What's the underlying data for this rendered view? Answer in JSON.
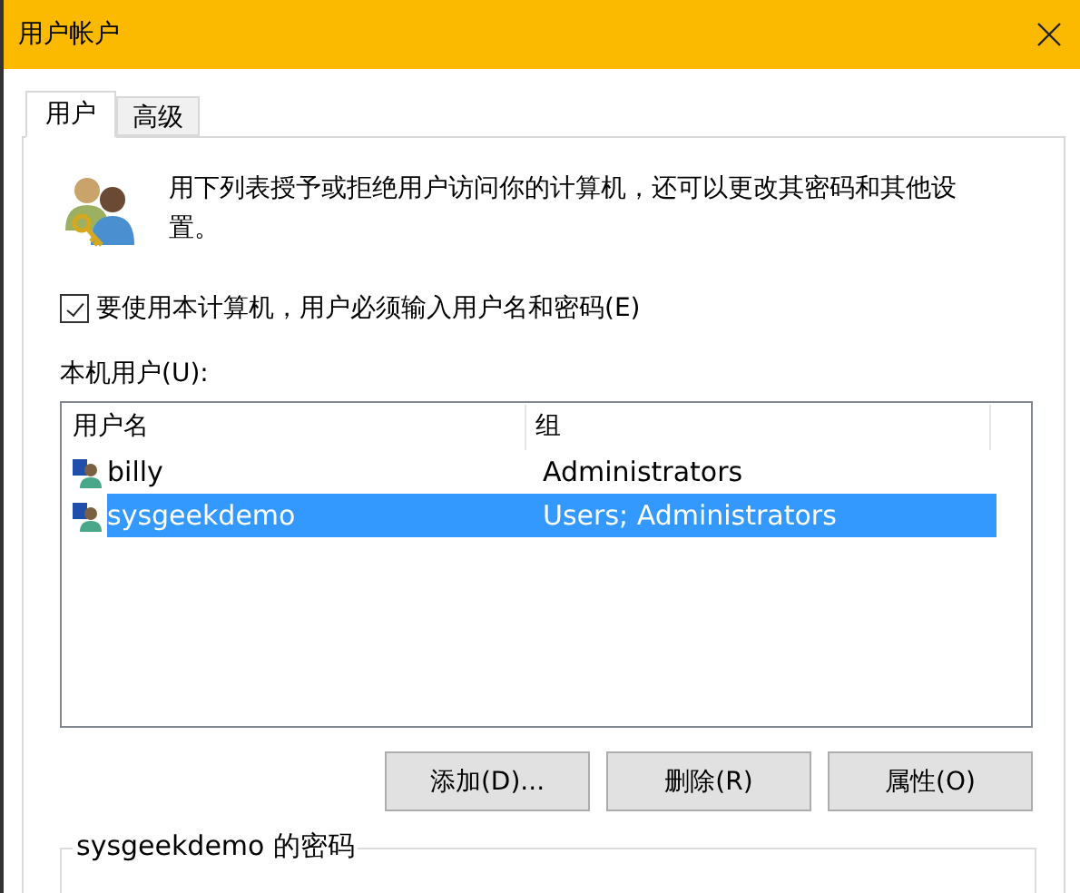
{
  "window": {
    "title": "用户帐户"
  },
  "tabs": [
    {
      "label": "用户",
      "selected": true
    },
    {
      "label": "高级",
      "selected": false
    }
  ],
  "description": "用下列表授予或拒绝用户访问你的计算机，还可以更改其密码和其他设置。",
  "require_password": {
    "label": "要使用本计算机，用户必须输入用户名和密码(E)",
    "checked": true
  },
  "users_label": "本机用户(U):",
  "table": {
    "columns": [
      "用户名",
      "组"
    ],
    "rows": [
      {
        "name": "billy",
        "group": "Administrators",
        "selected": false
      },
      {
        "name": "sysgeekdemo",
        "group": "Users; Administrators",
        "selected": true
      }
    ]
  },
  "buttons": [
    "添加(D)...",
    "删除(R)",
    "属性(O)"
  ],
  "password_group": {
    "title": "sysgeekdemo 的密码"
  }
}
